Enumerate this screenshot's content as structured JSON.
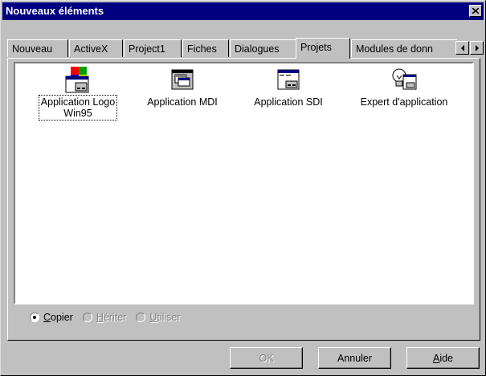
{
  "window": {
    "title": "Nouveaux éléments"
  },
  "tabs": [
    {
      "label": "Nouveau"
    },
    {
      "label": "ActiveX"
    },
    {
      "label": "Project1"
    },
    {
      "label": "Fiches"
    },
    {
      "label": "Dialogues"
    },
    {
      "label": "Projets",
      "active": true
    },
    {
      "label": "Modules de donn"
    }
  ],
  "items": [
    {
      "line1": "Application Logo",
      "line2": "Win95",
      "icon": "app-logo-icon",
      "selected": true
    },
    {
      "line1": "Application MDI",
      "line2": "",
      "icon": "app-mdi-icon"
    },
    {
      "line1": "Application SDI",
      "line2": "",
      "icon": "app-sdi-icon"
    },
    {
      "line1": "Expert d'application",
      "line2": "",
      "icon": "app-expert-icon"
    }
  ],
  "options": {
    "copier": {
      "pre": "",
      "u": "C",
      "post": "opier"
    },
    "heriter": {
      "pre": "",
      "u": "H",
      "post": "ériter"
    },
    "utiliser": {
      "pre": "",
      "u": "U",
      "post": "tiliser"
    }
  },
  "buttons": {
    "ok": "OK",
    "annuler": "Annuler",
    "aide_u": "A",
    "aide_rest": "ide"
  }
}
